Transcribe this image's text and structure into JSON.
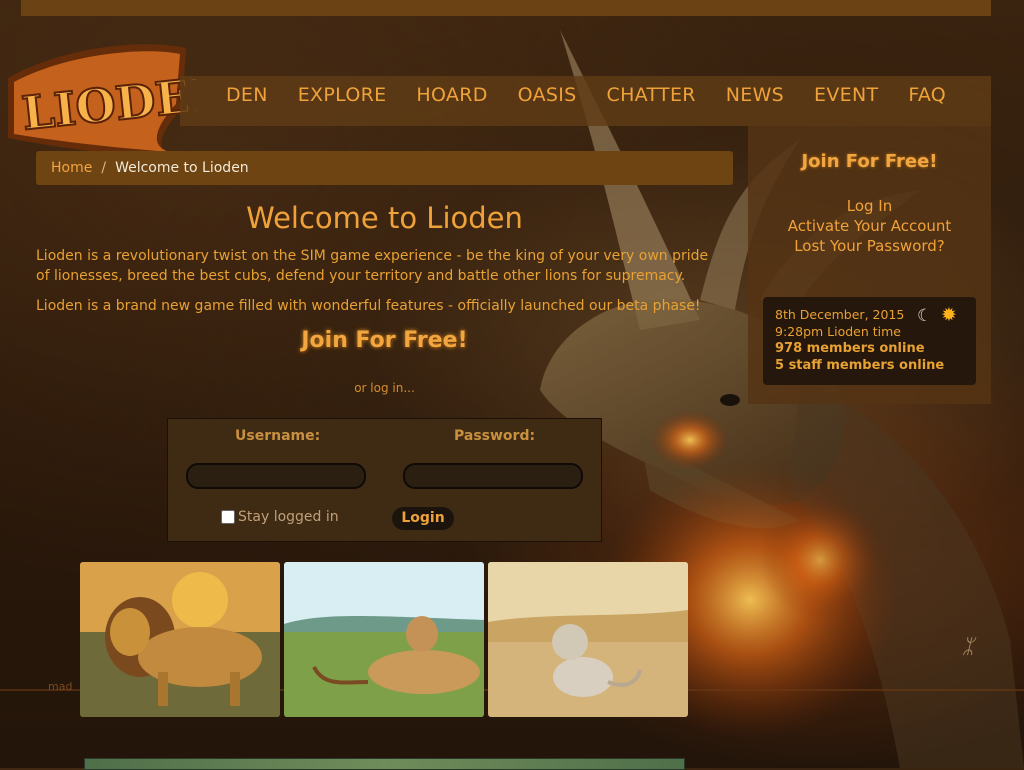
{
  "logo_text": "Lioden",
  "nav": {
    "items": [
      "DEN",
      "EXPLORE",
      "HOARD",
      "OASIS",
      "CHATTER",
      "NEWS",
      "EVENT",
      "FAQ"
    ]
  },
  "breadcrumb": {
    "home": "Home",
    "separator": "/",
    "current": "Welcome to Lioden"
  },
  "main": {
    "title": "Welcome to Lioden",
    "intro1": "Lioden is a revolutionary twist on the SIM game experience - be the king of your very own pride of lionesses, breed the best cubs, defend your territory and battle other lions for supremacy.",
    "intro2": "Lioden is a brand new game filled with wonderful features - officially launched our beta phase!",
    "join_label": "Join For Free!",
    "or_login": "or log in..."
  },
  "login": {
    "username_label": "Username:",
    "password_label": "Password:",
    "username_value": "",
    "password_value": "",
    "stay_logged_in_label": "Stay logged in",
    "stay_logged_in_checked": false,
    "submit_label": "Login"
  },
  "sidebar": {
    "join_label": "Join For Free!",
    "links": [
      "Log In",
      "Activate Your Account",
      "Lost Your Password?"
    ],
    "info": {
      "date": "8th December, 2015",
      "time": "9:28pm Lioden time",
      "members_online": "978 members online",
      "staff_online": "5 staff members online",
      "icons": [
        "moon-icon",
        "sun-icon"
      ]
    }
  },
  "footer_fragment": "mad",
  "colors": {
    "accent": "#f0a23a",
    "nav_bg": "#5f3c16",
    "breadcrumb_bg": "#6e4413",
    "panel_bg": "#553414",
    "info_bg": "#25170b"
  }
}
